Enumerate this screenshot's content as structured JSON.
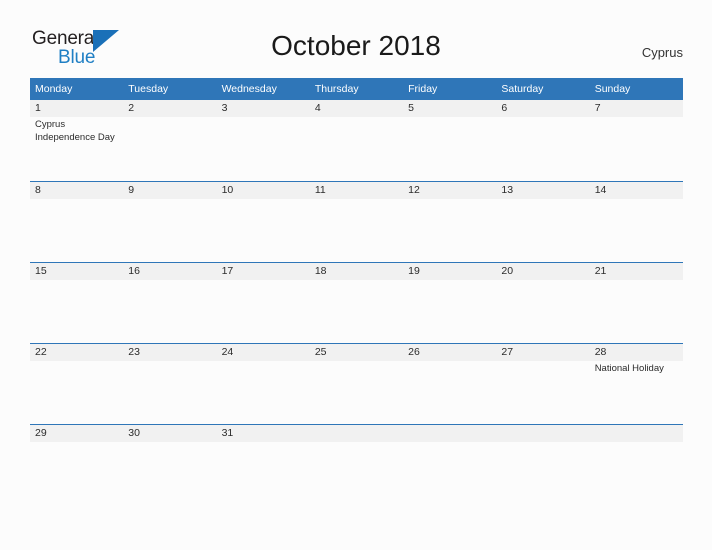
{
  "brand": {
    "logo_text_top": "General",
    "logo_text_bottom": "Blue",
    "logo_triangle_icon": "triangle-icon",
    "accent_color": "#2f76b8",
    "logo_blue_color": "#1f7fc4"
  },
  "header": {
    "title": "October 2018",
    "country": "Cyprus"
  },
  "calendar": {
    "weekday_headers": [
      "Monday",
      "Tuesday",
      "Wednesday",
      "Thursday",
      "Friday",
      "Saturday",
      "Sunday"
    ],
    "weeks": [
      [
        {
          "day": "1",
          "events": [
            "Cyprus",
            "Independence Day"
          ]
        },
        {
          "day": "2",
          "events": []
        },
        {
          "day": "3",
          "events": []
        },
        {
          "day": "4",
          "events": []
        },
        {
          "day": "5",
          "events": []
        },
        {
          "day": "6",
          "events": []
        },
        {
          "day": "7",
          "events": []
        }
      ],
      [
        {
          "day": "8",
          "events": []
        },
        {
          "day": "9",
          "events": []
        },
        {
          "day": "10",
          "events": []
        },
        {
          "day": "11",
          "events": []
        },
        {
          "day": "12",
          "events": []
        },
        {
          "day": "13",
          "events": []
        },
        {
          "day": "14",
          "events": []
        }
      ],
      [
        {
          "day": "15",
          "events": []
        },
        {
          "day": "16",
          "events": []
        },
        {
          "day": "17",
          "events": []
        },
        {
          "day": "18",
          "events": []
        },
        {
          "day": "19",
          "events": []
        },
        {
          "day": "20",
          "events": []
        },
        {
          "day": "21",
          "events": []
        }
      ],
      [
        {
          "day": "22",
          "events": []
        },
        {
          "day": "23",
          "events": []
        },
        {
          "day": "24",
          "events": []
        },
        {
          "day": "25",
          "events": []
        },
        {
          "day": "26",
          "events": []
        },
        {
          "day": "27",
          "events": []
        },
        {
          "day": "28",
          "events": [
            "National Holiday"
          ]
        }
      ],
      [
        {
          "day": "29",
          "events": []
        },
        {
          "day": "30",
          "events": []
        },
        {
          "day": "31",
          "events": []
        },
        {
          "day": "",
          "events": []
        },
        {
          "day": "",
          "events": []
        },
        {
          "day": "",
          "events": []
        },
        {
          "day": "",
          "events": []
        }
      ]
    ]
  }
}
